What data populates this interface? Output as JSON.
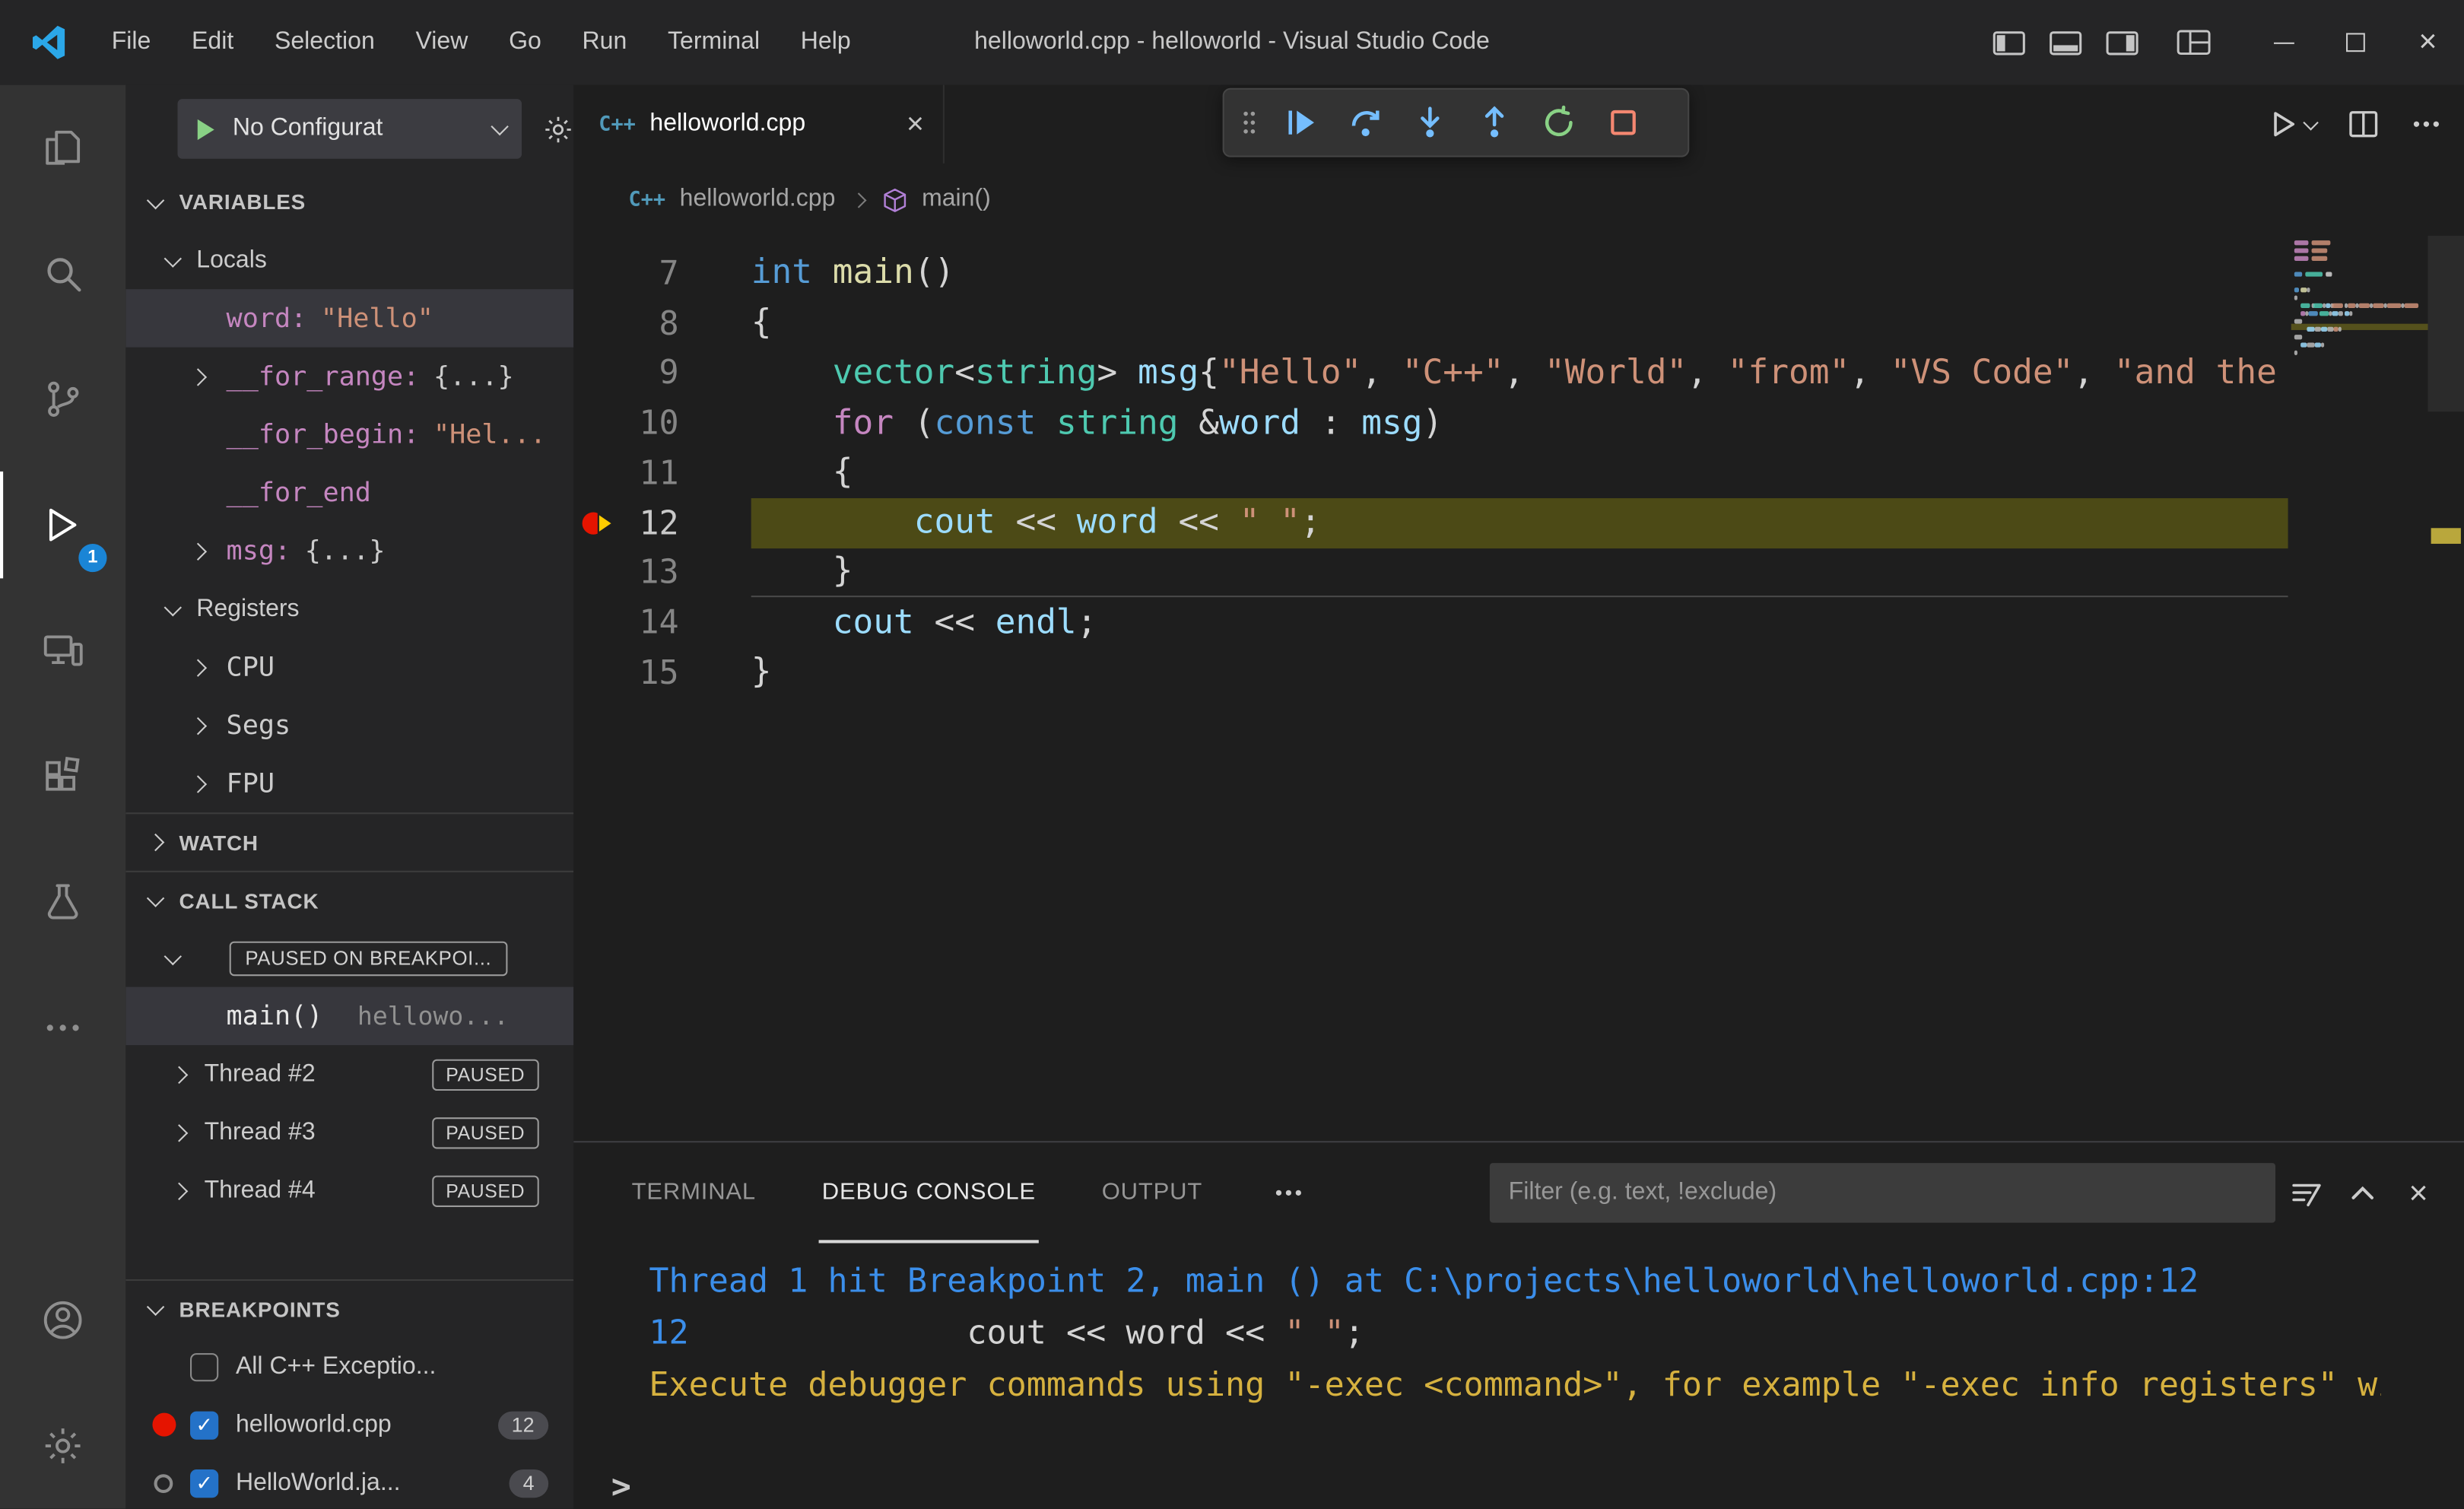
{
  "icons": {
    "close": "×",
    "check": "✓",
    "cpp_file": "C++"
  },
  "colors": {
    "accent_blue": "#007acc",
    "breakpoint_red": "#e51400",
    "debug_step_blue": "#75beff",
    "debug_restart_green": "#89d185",
    "debug_stop_red": "#f48771",
    "console_info_blue": "#3b8eea",
    "console_warn_yellow": "#d6b13f",
    "current_line_highlight": "#4c4a16"
  },
  "window": {
    "title": "helloworld.cpp - helloworld - Visual Studio Code",
    "menus": [
      "File",
      "Edit",
      "Selection",
      "View",
      "Go",
      "Run",
      "Terminal",
      "Help"
    ]
  },
  "activity_bar": {
    "badge": "1"
  },
  "debug_sidebar": {
    "config_label": "No Configurat",
    "variables": {
      "header": "VARIABLES",
      "groups": [
        {
          "label": "Locals",
          "items": [
            {
              "name": "word:",
              "value": "\"Hello\"",
              "valueType": "string",
              "selected": true,
              "chevron": "none"
            },
            {
              "name": "__for_range:",
              "value": "{...}",
              "valueType": "object",
              "chevron": "right"
            },
            {
              "name": "__for_begin:",
              "value": "\"Hel...",
              "valueType": "string",
              "chevron": "none"
            },
            {
              "name": "__for_end",
              "value": "",
              "valueType": "none",
              "chevron": "none"
            },
            {
              "name": "msg:",
              "value": "{...}",
              "valueType": "object",
              "chevron": "right"
            }
          ]
        },
        {
          "label": "Registers",
          "items": [
            {
              "name": "CPU",
              "value": "",
              "valueType": "none",
              "chevron": "right",
              "plain": true
            },
            {
              "name": "Segs",
              "value": "",
              "valueType": "none",
              "chevron": "right",
              "plain": true
            },
            {
              "name": "FPU",
              "value": "",
              "valueType": "none",
              "chevron": "right",
              "plain": true
            }
          ]
        }
      ]
    },
    "watch": {
      "header": "WATCH"
    },
    "call_stack": {
      "header": "CALL STACK",
      "status_badge": "PAUSED ON BREAKPOI...",
      "frames": [
        {
          "fn": "main()",
          "file": "hellowo...",
          "selected": true
        }
      ],
      "threads": [
        {
          "label": "Thread #2",
          "badge": "PAUSED"
        },
        {
          "label": "Thread #3",
          "badge": "PAUSED"
        },
        {
          "label": "Thread #4",
          "badge": "PAUSED"
        }
      ]
    },
    "breakpoints": {
      "header": "BREAKPOINTS",
      "items": [
        {
          "label": "All C++ Exceptio...",
          "checked": false,
          "marker": "none"
        },
        {
          "label": "helloworld.cpp",
          "checked": true,
          "marker": "red-dot",
          "count": "12"
        },
        {
          "label": "HelloWorld.ja...",
          "checked": true,
          "marker": "gray-circle",
          "count": "4"
        }
      ]
    }
  },
  "editor": {
    "tabs": [
      {
        "label": "helloworld.cpp",
        "active": true
      }
    ],
    "breadcrumbs": [
      {
        "label": "helloworld.cpp"
      },
      {
        "label": "main()"
      }
    ],
    "current_line": 12,
    "lines": [
      {
        "num": "7",
        "tokens": [
          [
            "int",
            "kw"
          ],
          [
            " ",
            "pl"
          ],
          [
            "main",
            "fn"
          ],
          [
            "()",
            "pl"
          ]
        ]
      },
      {
        "num": "8",
        "tokens": [
          [
            "{",
            "pl"
          ]
        ]
      },
      {
        "num": "9",
        "tokens": [
          [
            "    ",
            "pl"
          ],
          [
            "vector",
            "type"
          ],
          [
            "<",
            "pl"
          ],
          [
            "string",
            "type"
          ],
          [
            "> ",
            "pl"
          ],
          [
            "msg",
            "var"
          ],
          [
            "{",
            "pl"
          ],
          [
            "\"Hello\"",
            "str"
          ],
          [
            ", ",
            "pl"
          ],
          [
            "\"C++\"",
            "str"
          ],
          [
            ", ",
            "pl"
          ],
          [
            "\"World\"",
            "str"
          ],
          [
            ", ",
            "pl"
          ],
          [
            "\"from\"",
            "str"
          ],
          [
            ", ",
            "pl"
          ],
          [
            "\"VS Code\"",
            "str"
          ],
          [
            ", ",
            "pl"
          ],
          [
            "\"and the",
            "str"
          ]
        ]
      },
      {
        "num": "10",
        "tokens": [
          [
            "    ",
            "pl"
          ],
          [
            "for",
            "ctrl"
          ],
          [
            " (",
            "pl"
          ],
          [
            "const",
            "kw"
          ],
          [
            " ",
            "pl"
          ],
          [
            "string",
            "type"
          ],
          [
            " &",
            "pl"
          ],
          [
            "word",
            "var"
          ],
          [
            " : ",
            "pl"
          ],
          [
            "msg",
            "var"
          ],
          [
            ")",
            "pl"
          ]
        ]
      },
      {
        "num": "11",
        "tokens": [
          [
            "    {",
            "pl"
          ]
        ]
      },
      {
        "num": "12",
        "tokens": [
          [
            "        ",
            "pl"
          ],
          [
            "cout",
            "var"
          ],
          [
            " << ",
            "pl"
          ],
          [
            "word",
            "var"
          ],
          [
            " << ",
            "pl"
          ],
          [
            "\" \"",
            "str"
          ],
          [
            ";",
            "pl"
          ]
        ],
        "highlight": true,
        "breakpoint": "current"
      },
      {
        "num": "13",
        "tokens": [
          [
            "    }",
            "pl"
          ]
        ],
        "underline": true
      },
      {
        "num": "14",
        "tokens": [
          [
            "    ",
            "pl"
          ],
          [
            "cout",
            "var"
          ],
          [
            " << ",
            "pl"
          ],
          [
            "endl",
            "var"
          ],
          [
            ";",
            "pl"
          ]
        ]
      },
      {
        "num": "15",
        "tokens": [
          [
            "}",
            "pl"
          ]
        ]
      }
    ]
  },
  "debug_toolbar": {
    "buttons": [
      "continue",
      "step-over",
      "step-into",
      "step-out",
      "restart",
      "stop"
    ]
  },
  "panel": {
    "tabs": [
      {
        "label": "TERMINAL",
        "active": false
      },
      {
        "label": "DEBUG CONSOLE",
        "active": true
      },
      {
        "label": "OUTPUT",
        "active": false
      }
    ],
    "filter_placeholder": "Filter (e.g. text, !exclude)",
    "console_lines": [
      {
        "tokens": [
          [
            "Thread 1 hit Breakpoint 2, main () at C:\\projects\\helloworld\\helloworld.cpp:12",
            "info"
          ]
        ]
      },
      {
        "tokens": [
          [
            "12",
            "info"
          ],
          [
            "              cout << word << ",
            "pl"
          ],
          [
            "\" \"",
            "str"
          ],
          [
            ";",
            "pl"
          ]
        ]
      },
      {
        "tokens": [
          [
            "Execute debugger commands using \"-exec <command>\", for example \"-exec info registers\" will list registers in use (when GDB is the debugger)",
            "warn"
          ]
        ]
      }
    ],
    "prompt": ">"
  }
}
